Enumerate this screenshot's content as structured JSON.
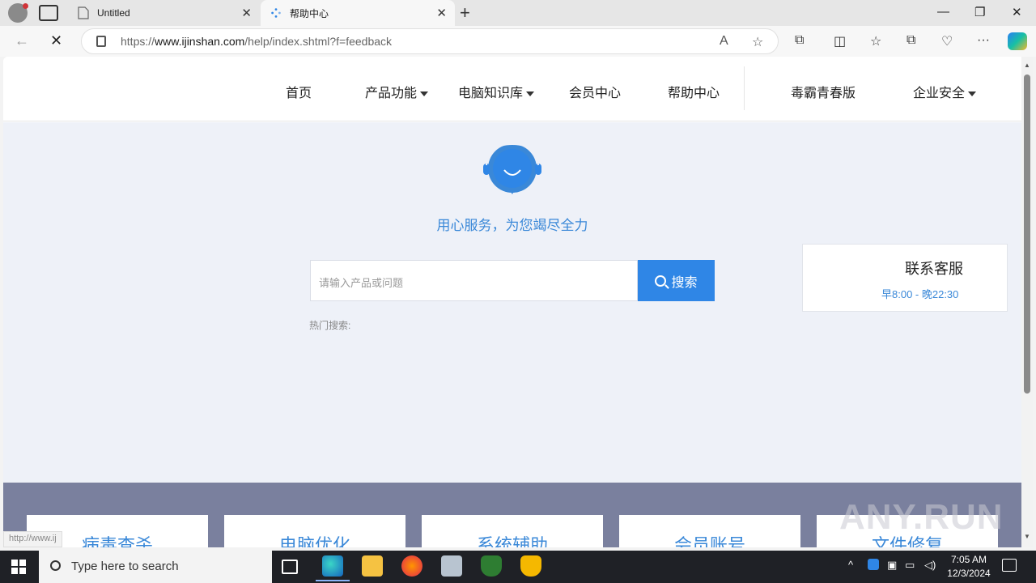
{
  "browser": {
    "tabs": [
      {
        "label": "Untitled",
        "active": false
      },
      {
        "label": "帮助中心",
        "active": true
      }
    ],
    "url_prefix": "https://",
    "url_host": "www.ijinshan.com",
    "url_path": "/help/index.shtml?f=feedback",
    "window_controls": {
      "minimize": "—",
      "restore": "❐",
      "close": "✕"
    },
    "new_tab": "+"
  },
  "site": {
    "nav": [
      {
        "label": "首页",
        "dropdown": false
      },
      {
        "label": "产品功能",
        "dropdown": true
      },
      {
        "label": "电脑知识库",
        "dropdown": true
      },
      {
        "label": "会员中心",
        "dropdown": false
      },
      {
        "label": "帮助中心",
        "dropdown": false
      },
      {
        "label": "毒霸青春版",
        "dropdown": false
      },
      {
        "label": "企业安全",
        "dropdown": true
      }
    ],
    "slogan": "用心服务，为您竭尽全力",
    "search": {
      "placeholder": "请输入产品或问题",
      "button": "搜索"
    },
    "hot_search": "热门搜索:",
    "service": {
      "title": "联系客服",
      "hours": "早8:00 - 晚22:30"
    },
    "cards": [
      "病毒查杀",
      "电脑优化",
      "系统辅助",
      "会员账号",
      "文件修复"
    ],
    "status_url": "http://www.ij",
    "watermark": "ANY.RUN"
  },
  "taskbar": {
    "search_placeholder": "Type here to search",
    "time": "7:05 AM",
    "date": "12/3/2024"
  },
  "colors": {
    "accent": "#2f86e6",
    "link_blue": "#3a88d8",
    "hero_bg": "#eef1f8",
    "band_bg": "#7a809e"
  }
}
